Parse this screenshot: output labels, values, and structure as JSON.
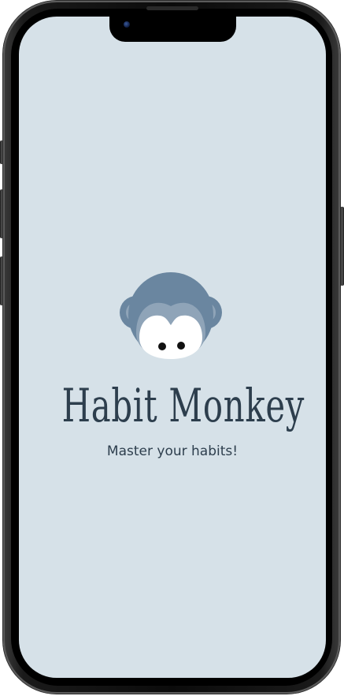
{
  "app": {
    "title": "Habit Monkey",
    "tagline": "Master your habits!"
  },
  "logo": {
    "icon": "monkey-face-icon"
  },
  "colors": {
    "screen_background": "#d6e1e8",
    "text": "#2d3e4d",
    "monkey_fur_dark": "#6a86a0",
    "monkey_fur_light": "#8fa4b8",
    "monkey_face": "#ffffff",
    "phone_frame": "#0b0b0b"
  }
}
